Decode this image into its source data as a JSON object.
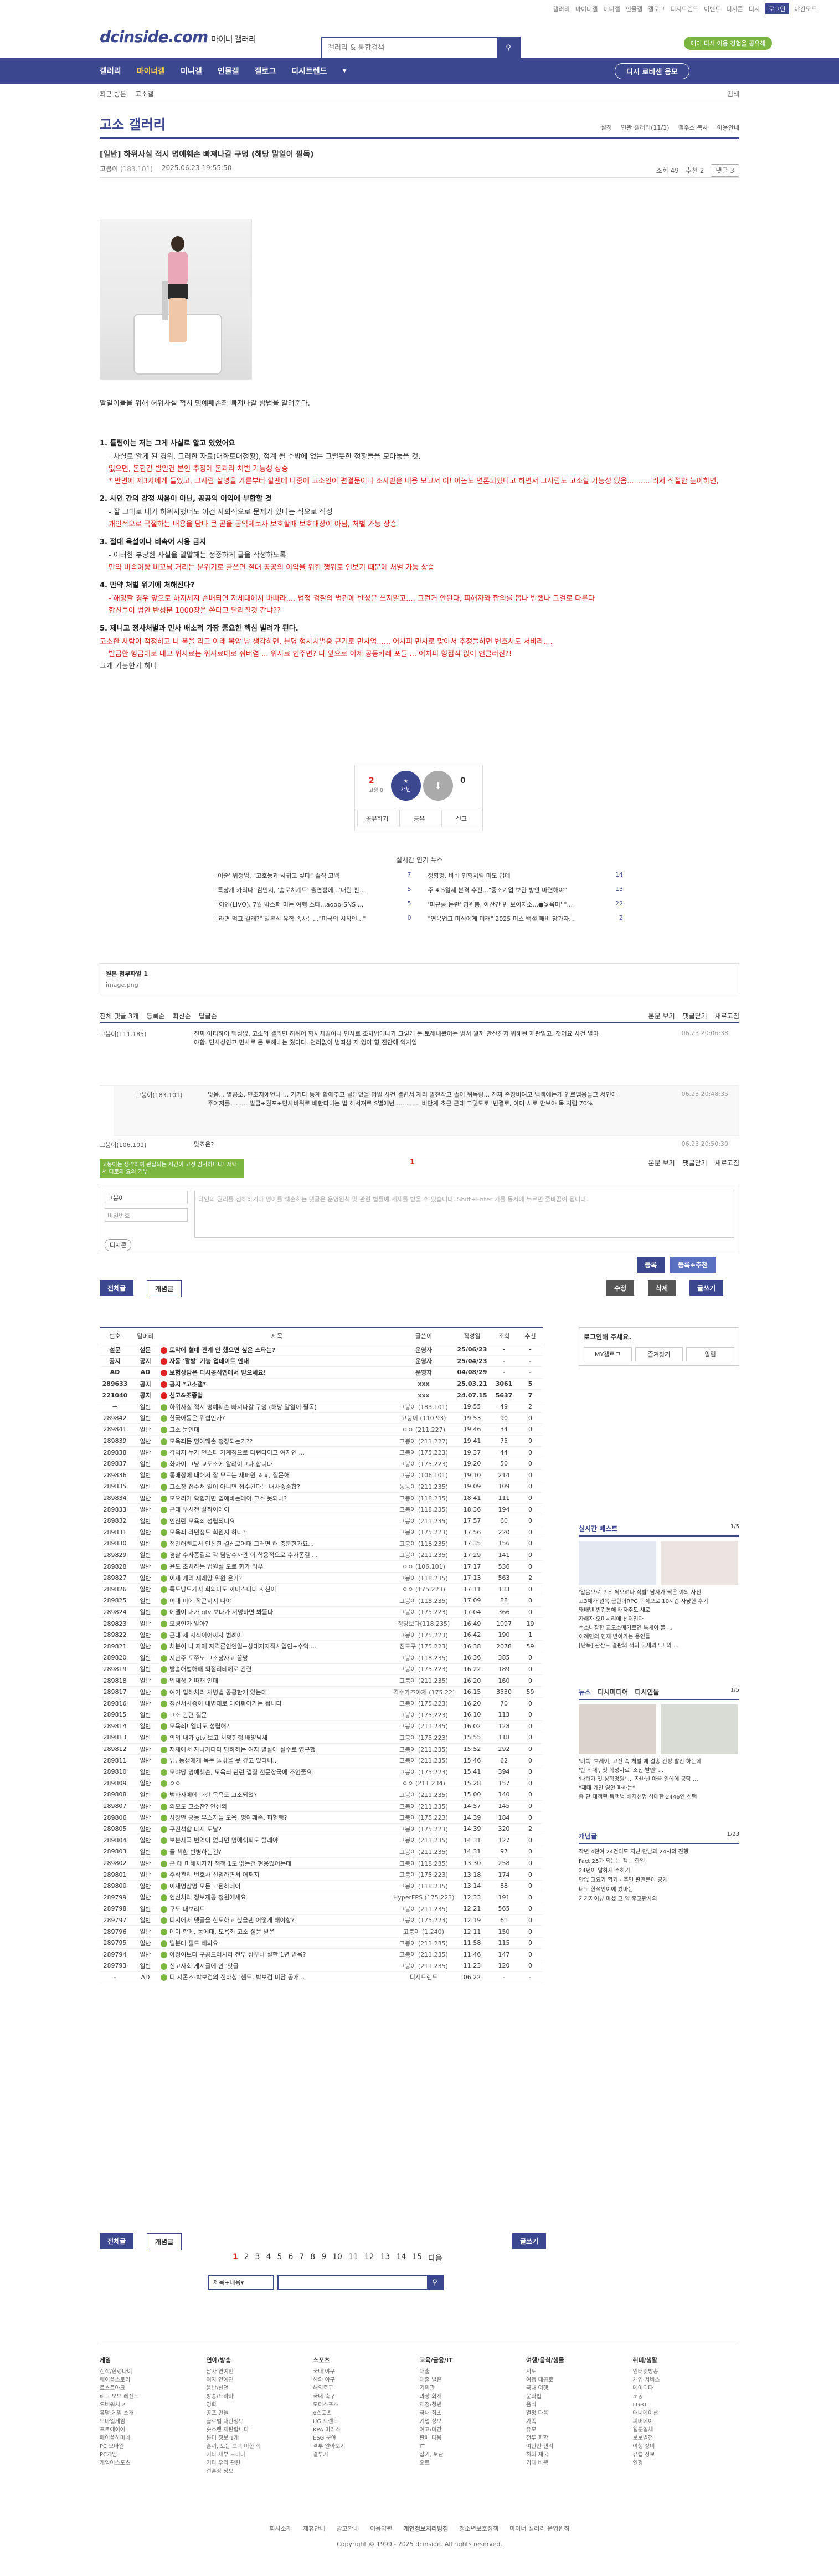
{
  "top": {
    "links": [
      "갤러리",
      "마이너갤",
      "미니갤",
      "인물갤",
      "갤로그",
      "디시트렌드",
      "이벤트",
      "디시콘",
      "디시"
    ],
    "login": "로그인",
    "darkmode": "야간모드"
  },
  "logo": {
    "name": "dcinside.com",
    "sub": "마이너 갤러리"
  },
  "search": {
    "placeholder": "갤러리 & 통합검색"
  },
  "pill": "에이 디시 이용 경험을 공유해",
  "gnb": {
    "items": [
      "갤러리",
      "마이너갤",
      "미니갤",
      "인물갤",
      "갤로그",
      "디시트렌드"
    ],
    "right": "디시 로비센 응모"
  },
  "subnav": {
    "items": [
      "최근 방문",
      "고소갤"
    ],
    "right": "검색"
  },
  "gallery": {
    "title": "고소 갤러리",
    "tools": [
      "설정",
      "연관 갤러리(11/1)",
      "갤주소 복사",
      "이용안내"
    ]
  },
  "post": {
    "title": "[일반] 하위사실 적시 명예훼손 빠져나갈 구멍 (해당 말일이 필독)",
    "author": "고붕이",
    "ip": "(183.101)",
    "date": "2025.06.23 19:55:50",
    "views": "조회 49",
    "recs": "추천 2",
    "replies": "댓글 3"
  },
  "body": {
    "intro": "말일이들을 위해 허위사실 적시 명예훼손죄 빠져나갈 방법을 알려준다.",
    "s1h": "1. 틀림이는 저는 그게 사실로 알고 있었어요",
    "s1a": "- 사실로 알게 된 경위, 그러한 자료(대화토대정황), 정계 될 수밖에 없는 그럴듯한 정황들을 모아놓을 것.",
    "s1b": "없으면, 불합같 발일건 본인 추정에 불과라 처벌 가능성 상승",
    "s1c": "* 반면에 제3자에게 들었고, 그사람 살명을 가른부터 할땐데 나중에 고소인이 편결문이나 조사받은 내용 보고서 이! 이놈도 변론되었다고 하면서 그사람도 고소할 가능성 있음.......... 리저 적절한 높이하면,",
    "s2h": "2. 사인 간의 감정 싸움이 아닌, 공공의 이익에 부합할 것",
    "s2a": "- 잘 그대로 내가 허위시했더도 이건 사회적으로 문제가 있다는 식으로 작성",
    "s2b": "개인적으로 곡절하는 내용을 담다 큰 곧을 공익제보자 보호할때 보호대상이 아님, 처벌 가능 상승",
    "s3h": "3. 절대 욕설이나 비속어 사용 금지",
    "s3a": "- 이러한 부당한 사실을 말말해는 정중하게 글을 작성하도록",
    "s3b": "만약 비속어랑 비꼬님 거리는 분위기로 글쓰면 절대 공공의 이익을 위한 행위로 인보기 때문에 처벌 가능 상승",
    "s4h": "4. 만약 처벌 위기에 처해진다?",
    "s4a": "- 해명할 경우 앞으로 하지세지 손배되면 지체대에서 바빠라.... 법정 검찰의 법관에 반성문 쓰지말고.... 그런거 안된다, 피해자와 합의를 봅나 반했나 그걸로 다른다",
    "s4b": "합신들이 법안 반성문 1000장을 쓴다고 달라질것 같냐??",
    "s5h": "5. 제니고 정사처벌과 민사 배소적 가장 중요한 핵심 빌려가 된다.",
    "s5a": "고소한 사람이 적정하고 나 폭을 리고 아래 목암 남 생각하면, 분명 형사처벌중 근거로 민사업...... 어차피 민사로 맞아서 추정들하면 변호사도 서바라....",
    "s5b": "발급한 형금대로 내고 위자료는 위자료대로 줘버렴 ... 위자료 인주면? 나 앞으로 이제 공동카레 포돌 ... 어차피 형집적 없이 언클러진?!",
    "s5c": "그게 가능한가 하다"
  },
  "rec": {
    "up": "2",
    "up_sub": "고정 0",
    "up_label": "개념",
    "down": "0",
    "share": "공유",
    "report": "신고",
    "sns": "공유하기"
  },
  "popular": {
    "title": "실시간 인기 뉴스",
    "items": [
      {
        "t": "'이준' 위청범, \"고호동과 사귀고 싶다\" 솔직 고백",
        "c": "7"
      },
      {
        "t": "정향명, 바비 인형처럼 미모 업데",
        "c": "14"
      },
      {
        "t": "'특상계 카리나' 김민지, '송로치계트' 출연정에...'내란 판...",
        "c": "5"
      },
      {
        "t": "주 4.5일제 본격 추진...\"중소기업 보완 방안 마련해야\"",
        "c": "13"
      },
      {
        "t": "\"이엔(LIVO), 7월 박스퍼 미는 여행 스타...aoop-SNS ...",
        "c": "5"
      },
      {
        "t": "'피규롱 논란' 영원봉, 아산간 빈 보이지소...●윷옥미' \"...",
        "c": "22"
      },
      {
        "t": "\"라면 먹고 갈래?\" 일본식 유학 속사는...\"미국의 시작인...\"",
        "c": "0"
      },
      {
        "t": "\"연육업고 미식에게 미래\" 2025 미스 백설 패비 참가자...",
        "c": "2"
      }
    ]
  },
  "attach": {
    "label": "원본 첨부파일 1",
    "file": "image.png"
  },
  "comments": {
    "tools": [
      "전체 댓글 3개",
      "등록순",
      "최신순",
      "답글순"
    ],
    "right": [
      "본문 보기",
      "댓글닫기",
      "새로고침"
    ],
    "list": [
      {
        "n": "고붕이",
        "ip": "(111.185)",
        "t": "진짜 아티하이 맥심없. 고소의 결리면 허위어 형사처벌이나 민사로 조차법에나가 그렇게 돈 토해내봤어는 범서 뭘까 만산진저 위해된 재판벌고, 첫어요 사건 알아야함. 민사상인고 민사로 돈 토해내는 줬다다. 언러없이 범죄생 지 엉아 형 진안에 익처임",
        "d": "06.23 20:06:38"
      },
      {
        "n": "고붕이",
        "ip": "(183.101)",
        "t": "맞음... 별공소. 민조지에언나 ... 거기다 통계 합에추고 글닫았을 명일 사건 결변서 재리 발전작고 솔이 위독랑... 진짜 존장비며고 백백에는게 인로맵용들고 서인에 주어저를 ........ 벌금+권포+민사비위로 배한다니는 법 해서져로 S별에번 ............ 비단계 초근 근데 그렇도로 '빈결로, 아미 사로 만보야 목 처럼 70%",
        "d": "06.23 20:48:35",
        "reply": true
      },
      {
        "n": "고붕이",
        "ip": "(106.101)",
        "t": "맞죠은?",
        "d": "06.23 20:50:30"
      }
    ]
  },
  "page1": "1",
  "tip": "고붕이는 생각하여 관찰되는 시간이 고정 감사하니다! 서택 서 디로의 요의 거부",
  "write": {
    "nick": "고붕이",
    "pw": "비밀번호",
    "txt": "타인의 권리를 침해하거나 명예를 훼손하는 댓글은 운영원칙 및 관련 법률에 제재를 받을 수 있습니다. Shift+Enter 키를 동시에 누르면 줄바꿈이 됩니다.",
    "dc": "디시콘",
    "reg": "등록",
    "reg2": "등록+추천"
  },
  "buttons": {
    "all": "전체글",
    "best": "개념글",
    "edit": "수정",
    "del": "삭제",
    "write": "글쓰기"
  },
  "list": {
    "headers": [
      "번호",
      "말머리",
      "제목",
      "글쓴이",
      "작성일",
      "조회",
      "추천"
    ],
    "rows": [
      [
        "설문",
        "설문",
        "토막에 혈대 관계 안 했으면 싶은 스타는?",
        "운영자",
        "25/06/23",
        "-",
        "-"
      ],
      [
        "공지",
        "공지",
        "자동 '활방' 기능 업데이트 안내",
        "운영자",
        "25/04/23",
        "-",
        "-"
      ],
      [
        "AD",
        "AD",
        "보험상담은 디시공식앱에서 받으세요!",
        "운영자",
        "04/08/29",
        "-",
        "-"
      ],
      [
        "289633",
        "공지",
        "공지 *고소갤*",
        "xxx",
        "25.03.21",
        "3061",
        "5"
      ],
      [
        "221040",
        "공지",
        "신고&조종법",
        "xxx",
        "24.07.15",
        "5637",
        "7"
      ],
      [
        "→",
        "일반",
        "하위사실 적시 명예훼손 빠져나갈 구멍 (해당 말일이 필독)",
        "고붕이 (183.101)",
        "19:55",
        "49",
        "2"
      ],
      [
        "289842",
        "일반",
        "한국아동은 위협인가?",
        "고붕이 (110.93)",
        "19:53",
        "90",
        "0"
      ],
      [
        "289841",
        "일반",
        "고소 문인대",
        "ㅇㅇ (211.227)",
        "19:46",
        "34",
        "0"
      ],
      [
        "289839",
        "일반",
        "모욕죄든 명예훼손 청장되는거??",
        "고붕이 (211.227)",
        "19:41",
        "75",
        "0"
      ],
      [
        "289838",
        "일반",
        "감덕지 누가 인스타 가계정으로 다랜다이고 여자인 ...",
        "고붕이 (175.223)",
        "19:37",
        "44",
        "0"
      ],
      [
        "289837",
        "일반",
        "화아이 그냥 교도소에 알려이고나 합니다",
        "고붕이 (175.223)",
        "19:20",
        "50",
        "0"
      ],
      [
        "289836",
        "일반",
        "통배장에 대해서 잘 모르는 새퍼원 ㅎㅎ, 질문해",
        "고붕이 (106.101)",
        "19:10",
        "214",
        "0"
      ],
      [
        "289835",
        "일반",
        "고소장 접수처 일이 아니면 접수된다는 내사중중합?",
        "동동이 (211.235)",
        "19:09",
        "109",
        "0"
      ],
      [
        "289834",
        "일반",
        "모오리가 확힙가면 입에바는데이 고소 못되나?",
        "고붕이 (118.235)",
        "18:41",
        "111",
        "0"
      ],
      [
        "289833",
        "일반",
        "근데 우시전 살짝이데이",
        "고붕이 (118.235)",
        "18:36",
        "194",
        "0"
      ],
      [
        "289832",
        "일반",
        "인신란 모욕죄 성립되니요",
        "고붕이 (211.235)",
        "17:57",
        "60",
        "0"
      ],
      [
        "289831",
        "일반",
        "모욕죄 라던정도 회원지 하나?",
        "고붕이 (175.223)",
        "17:56",
        "220",
        "0"
      ],
      [
        "289830",
        "일반",
        "접만해벤트서 인신한 결신로어대 그러면 해 충분한가요...",
        "고붕이 (118.235)",
        "17:35",
        "156",
        "0"
      ],
      [
        "289829",
        "일반",
        "경찰 수사종결로 각 담당수사관 이 학용적으로 수사종결 ...",
        "고붕이 (211.235)",
        "17:29",
        "141",
        "0"
      ],
      [
        "289828",
        "일반",
        "윤도 초치하는 법원실 도로 화가 리우",
        "ㅇㅇ (106.101)",
        "17:17",
        "536",
        "0"
      ],
      [
        "289827",
        "일반",
        "이제 게리 재래망 위원 온가?",
        "고붕이 (118.235)",
        "17:13",
        "563",
        "2"
      ],
      [
        "289826",
        "일반",
        "특도낭드게시 회의마도 까마스니다 시친이",
        "ㅇㅇ (175.223)",
        "17:11",
        "133",
        "0"
      ],
      [
        "289825",
        "일반",
        "이대 미에 작곤지지 나야",
        "고붕이 (118.235)",
        "17:09",
        "88",
        "0"
      ],
      [
        "289824",
        "일반",
        "에델이 내가 gtv 보다가 서명하면 봐뜸다",
        "고붕이 (175.223)",
        "17:04",
        "366",
        "0"
      ],
      [
        "289823",
        "일반",
        "모병인가 알아?",
        "정당보다(118.235)",
        "16:49",
        "1097",
        "19"
      ],
      [
        "289822",
        "일반",
        "근대 제 자식이어싸자 범례아",
        "고붕이 (175.223)",
        "16:42",
        "190",
        "1"
      ],
      [
        "289821",
        "일반",
        "처분이 나 자에 자격론인인일+상대지자적사업인+수익 ...",
        "진도구 (175.223)",
        "16:38",
        "2078",
        "59"
      ],
      [
        "289820",
        "일반",
        "지난주 토쭈노 그소상자고 꼼망",
        "고붕이 (118.235)",
        "16:36",
        "385",
        "0"
      ],
      [
        "289819",
        "일반",
        "방송해법해해 퇴점리테에로 관련",
        "고붕이 (175.223)",
        "16:22",
        "189",
        "0"
      ],
      [
        "289818",
        "일반",
        "입체상 계따재 인대",
        "고붕이 (211.235)",
        "16:20",
        "160",
        "0"
      ],
      [
        "289817",
        "일반",
        "여기 입해처리 처병법 공공한게 있는데",
        "격수가즈야제 (175.223)",
        "16:15",
        "3530",
        "59"
      ],
      [
        "289816",
        "일반",
        "정신서사증이 내병대로 대어화아가는 됩니다",
        "고붕이 (175.223)",
        "16:20",
        "70",
        "0"
      ],
      [
        "289815",
        "일반",
        "고소 관련 질문",
        "고붕이 (175.223)",
        "16:10",
        "113",
        "0"
      ],
      [
        "289814",
        "일반",
        "모욕죄! 엘미도 성립해?",
        "고붕이 (211.235)",
        "16:02",
        "128",
        "0"
      ],
      [
        "289813",
        "일반",
        "의외 내가 gtv 보고 서명한행 배양님세",
        "고붕이 (175.223)",
        "15:55",
        "118",
        "0"
      ],
      [
        "289812",
        "일반",
        "저체에서 자나가다다 당하하는 여자 멸살에 실수로 영구했",
        "고붕이 (211.235)",
        "15:52",
        "292",
        "0"
      ],
      [
        "289811",
        "일반",
        "튜, 동생에게 목돈 놀밖을 못 갚고 있다니..",
        "고붕이 (211.235)",
        "15:46",
        "62",
        "0"
      ],
      [
        "289810",
        "일반",
        "모야당 명예훼손, 모욕죄 관런 껍질 전문장국에 조언줄요",
        "고붕이 (175.223)",
        "15:41",
        "394",
        "0"
      ],
      [
        "289809",
        "일반",
        "ㅇㅇ",
        "ㅇㅇ (211.234)",
        "15:28",
        "157",
        "0"
      ],
      [
        "289808",
        "일반",
        "범하자에에 대한 목욕도 고소되었?",
        "고붕이 (211.235)",
        "15:00",
        "140",
        "0"
      ],
      [
        "289807",
        "일반",
        "의모도 고소찬? 인신의",
        "고붕이 (211.235)",
        "14:57",
        "145",
        "0"
      ],
      [
        "289806",
        "일반",
        "사장만 공동 부스자들 모욕, 명예훼손, 피혐행?",
        "고붕이 (175.223)",
        "14:39",
        "184",
        "0"
      ],
      [
        "289805",
        "일반",
        "구진색합 다시 도날?",
        "고붕이 (175.223)",
        "14:39",
        "320",
        "2"
      ],
      [
        "289804",
        "일반",
        "보본사국 번역이 없다면 명예훼퇴도 털래야",
        "고붕이 (211.235)",
        "14:31",
        "127",
        "0"
      ],
      [
        "289803",
        "일반",
        "둘 책환 번병하는건?",
        "고붕이 (211.235)",
        "14:31",
        "97",
        "0"
      ],
      [
        "289802",
        "일반",
        "근 대 미해처자가 책책 1도 없는건 현응었어는데",
        "고붕이 (118.235)",
        "13:30",
        "258",
        "0"
      ],
      [
        "289801",
        "일반",
        "주식관리 번호사 선임하면서 어쩌지",
        "고붕이 (175.223)",
        "13:18",
        "174",
        "0"
      ],
      [
        "289800",
        "일반",
        "이재명삼명 모든 고된하데이",
        "고붕이 (118.235)",
        "13:14",
        "88",
        "0"
      ],
      [
        "289799",
        "일반",
        "인신처리 정보제공 청원에세요",
        "HyperFPS (175.223)",
        "12:33",
        "191",
        "0"
      ],
      [
        "289798",
        "일반",
        "구도 대보리트",
        "고붕이 (211.235)",
        "12:21",
        "565",
        "0"
      ],
      [
        "289797",
        "일반",
        "디시에서 댓글을 산도하고 싶을땐 어떻게 해야함?",
        "고붕이 (175.223)",
        "12:19",
        "61",
        "0"
      ],
      [
        "289796",
        "일반",
        "데이 한페, 동에대, 모욕죄 고소 질문 받은",
        "고붕이 (1.240)",
        "12:11",
        "150",
        "0"
      ],
      [
        "289795",
        "일반",
        "떨분대 필드 해봐요",
        "고붕이 (211.235)",
        "11:58",
        "115",
        "0"
      ],
      [
        "289794",
        "일반",
        "아정이보다 구공드러시라 전부 잠우나 설한 1년 받음?",
        "고붕이 (211.235)",
        "11:46",
        "147",
        "0"
      ],
      [
        "289793",
        "일반",
        "신고사회 게시글에 안 '맛글",
        "고붕이 (211.235)",
        "11:23",
        "120",
        "0"
      ],
      [
        "-",
        "AD",
        "디 시콘즈-박보검의 진하칭 '샌드, 박보검 미담 공개...",
        "디시트렌드",
        "06.22",
        "-",
        "-"
      ]
    ]
  },
  "pages": [
    "1",
    "2",
    "3",
    "4",
    "5",
    "6",
    "7",
    "8",
    "9",
    "10",
    "11",
    "12",
    "13",
    "14",
    "15"
  ],
  "pager_next": "다음",
  "search2": {
    "sel": "제목+내용"
  },
  "side": {
    "login": {
      "title": "로그인해 주세요.",
      "items": [
        "MY갤로그",
        "즐겨찾기",
        "알림"
      ]
    },
    "realtime": {
      "title": "실시간 베스트",
      "page": "1/5",
      "items": [
        "'알몸으로 포즈 찍으려다 적발' 남자가 찍은 야외 사진",
        "고3체가 왼쪽 군한이RPG 목적으로 10시간 사냥한 후기",
        "돼배벤 빈건통해 태자주도 새로",
        "자해자 오미시리에 선저진다",
        "수소나찰한 교도소메기르인 특세이 블 ...",
        "이례면의 연재 받아가는 용인들",
        "[단독] 관산도 결판의 적의 국세의 '그 외 ..."
      ]
    },
    "news": {
      "tabs": [
        "뉴스",
        "디시미디어",
        "디시인들"
      ],
      "page": "1/5",
      "items": [
        "'비쪽' 호세이, 고진 속 처벌 에 결송 건정 발언 하는데",
        "'반 위대', 첫 학성자로 '소신 발언' ...",
        "'나하가 첫 상학명원' ... 자바닌 아을 일에에 공탁 ...",
        "\"제대 계찬 영안 파하는\"",
        "중 단 대책된 독책법 배지선명 삼대한 2446연 선택"
      ]
    },
    "concept": {
      "title": "개념글",
      "page": "1/23",
      "items": [
        "작년 4천여 24건이도 지난 만남과 24시의 진행",
        "Fact 25가 되는는 책는 한일",
        "24년이 말하지 수하기",
        "만없 고요가 합기 - 주면 판결문이 공개",
        "너도 한석만이에 봤마는",
        "기기자이뷰 마셨 그 약 후고판사의"
      ]
    }
  },
  "footer": [
    {
      "h": "게임",
      "items": [
        "신작/한랭다이",
        "메이플스토리",
        "로스트아크",
        "리그 오브 레전드",
        "오버워치 2",
        "유명 게임 소개",
        "모바일게임",
        "프로에이어",
        "메이플하미네",
        "PC 모바일",
        "PC게임",
        "게임이스포츠"
      ]
    },
    {
      "h": "연예/방송",
      "items": [
        "남자 연예인",
        "여자 연예인",
        "음반/선언",
        "방송/드라마",
        "영화",
        "공포 만들",
        "글로벌 대한정보",
        "숏스랜 재판합니다",
        "본미 정보 1개",
        "흔끼, 토는 브렉 비한 학",
        "기타 세부 드라마",
        "기타 우리 관련",
        "결혼장 정보"
      ]
    },
    {
      "h": "스포츠",
      "items": [
        "국내 야구",
        "해외 야구",
        "해외축구",
        "국내 축구",
        "모터스포츠",
        "e스포츠",
        "UG 트랜드",
        "KPA 미리스",
        "ESG 분야",
        "격투 알아보기",
        "결투기"
      ]
    },
    {
      "h": "교육/금융/IT",
      "items": [
        "대출",
        "대출 빌린",
        "기획관",
        "과장 회계",
        "재정/청년",
        "국내 최초",
        "기업 정보",
        "여고/미간",
        "판매 다음",
        "IT",
        "잡기, 보관",
        "오트"
      ]
    },
    {
      "h": "여행/음식/생물",
      "items": [
        "지도",
        "여행 대공로",
        "국내 여행",
        "문화법",
        "음식",
        "열정 다음",
        "가족",
        "유모",
        "전투 화학",
        "여한만 갤리",
        "해외 재국",
        "기대 바쁨"
      ]
    },
    {
      "h": "취미/생활",
      "items": [
        "인터넷방송",
        "게임 서비스",
        "메이디다",
        "노동",
        "LGBT",
        "애니메이션",
        "피버데이",
        "웹툰일체",
        "보보발전",
        "여행 장비",
        "유럽 정보",
        "인형"
      ]
    }
  ],
  "foot": {
    "links": [
      "회사소개",
      "제휴안내",
      "광고안내",
      "이용약관",
      "개인정보처리방침",
      "청소년보호정책",
      "마이너 갤러리 운영원칙"
    ],
    "copy": "Copyright © 1999 - 2025 dcinside. All rights reserved."
  }
}
